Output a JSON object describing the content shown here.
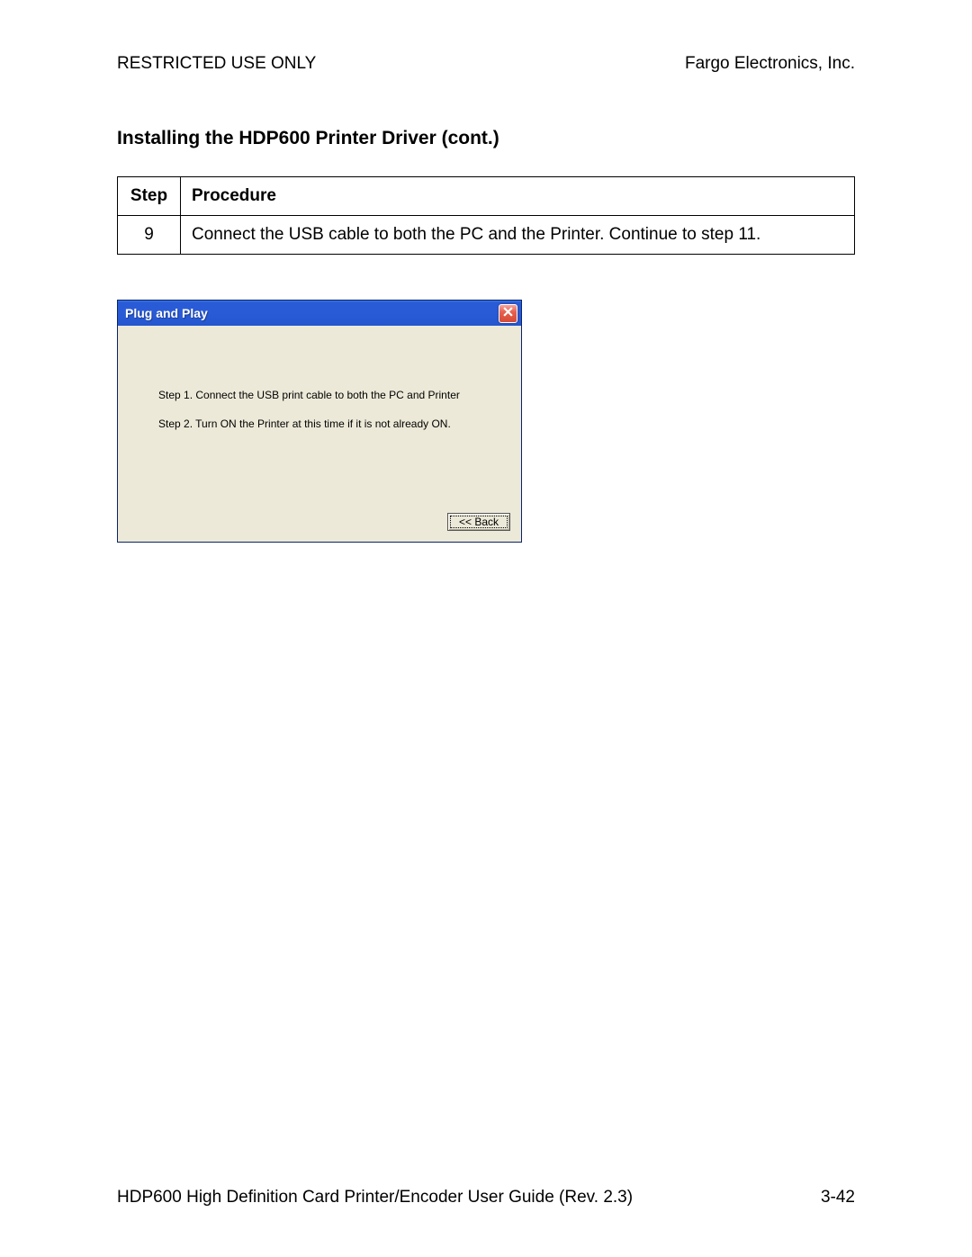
{
  "header": {
    "left": "RESTRICTED USE ONLY",
    "right": "Fargo Electronics, Inc."
  },
  "section_title": "Installing the HDP600 Printer Driver (cont.)",
  "table": {
    "headers": {
      "step": "Step",
      "procedure": "Procedure"
    },
    "rows": [
      {
        "step": "9",
        "procedure": "Connect the USB cable to both the PC and the Printer. Continue to step 11."
      }
    ]
  },
  "dialog": {
    "title": "Plug and Play",
    "lines": [
      "Step 1.  Connect the USB print cable to both the PC and Printer",
      "Step 2.  Turn ON the Printer at this time if it is not already ON."
    ],
    "back_label": "<< Back"
  },
  "footer": {
    "left": "HDP600 High Definition Card Printer/Encoder User Guide (Rev. 2.3)",
    "right": "3-42"
  }
}
